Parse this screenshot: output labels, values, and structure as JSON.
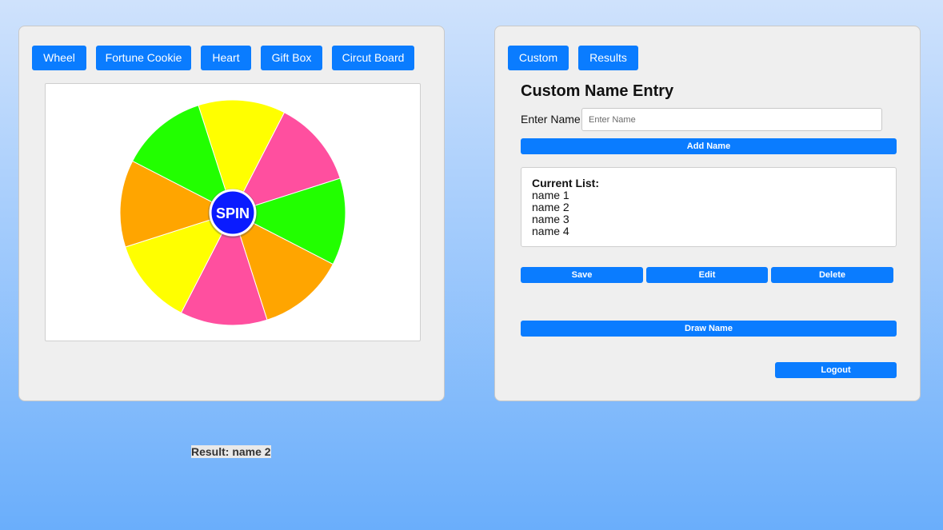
{
  "left_panel": {
    "tabs": [
      {
        "label": "Wheel"
      },
      {
        "label": "Fortune Cookie"
      },
      {
        "label": "Heart"
      },
      {
        "label": "Gift Box"
      },
      {
        "label": "Circut Board"
      }
    ],
    "wheel": {
      "spin_label": "SPIN",
      "segment_colors": [
        "#ffff00",
        "#ff4f9f",
        "#22ff00",
        "#ffa500",
        "#ff4f9f",
        "#ffff00",
        "#ffa500",
        "#22ff00"
      ],
      "hub_color": "#0a1bff"
    }
  },
  "right_panel": {
    "tabs": [
      {
        "label": "Custom"
      },
      {
        "label": "Results"
      }
    ],
    "title": "Custom Name Entry",
    "name_label": "Enter Name:",
    "name_placeholder": "Enter Name",
    "add_button": "Add Name",
    "list_title": "Current List:",
    "names": [
      "name 1",
      "name 2",
      "name 3",
      "name 4"
    ],
    "save_button": "Save",
    "edit_button": "Edit",
    "delete_button": "Delete",
    "draw_button": "Draw Name",
    "logout_button": "Logout"
  },
  "result": "Result: name 2",
  "colors": {
    "accent": "#0a7cff",
    "panel_bg": "#efefef"
  }
}
